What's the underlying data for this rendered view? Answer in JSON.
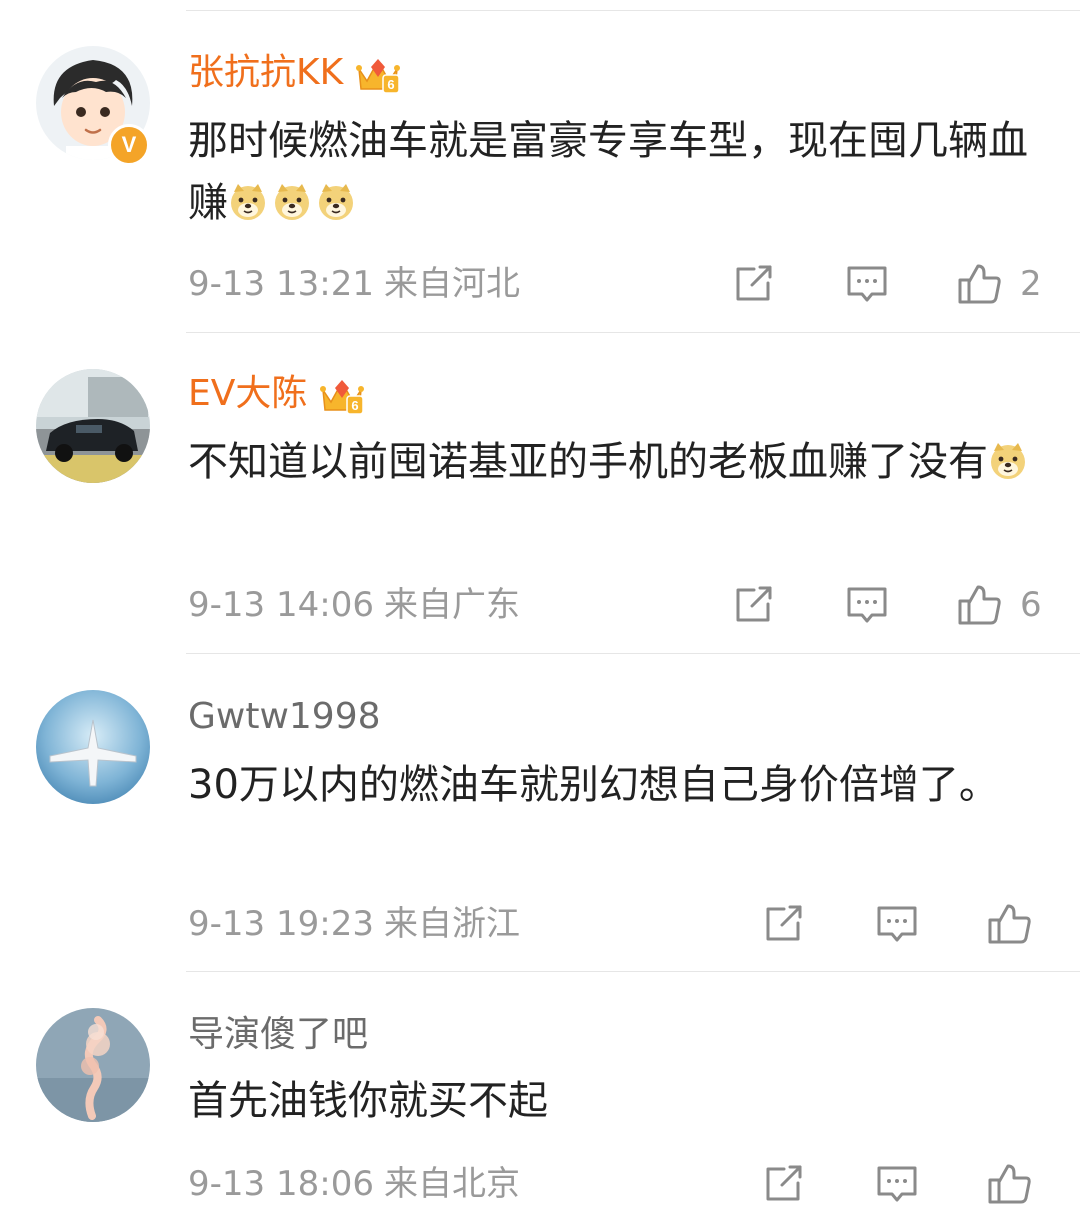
{
  "comments": [
    {
      "username": "张抗抗KK",
      "user_style": "vip",
      "verified": true,
      "verified_badge": "V",
      "crown_icon": "vip-crown-level-6",
      "content": "那时候燃油车就是富豪专享车型，现在囤几辆血赚",
      "emojis": [
        "doge",
        "doge",
        "doge"
      ],
      "time": "9-13 13:21",
      "location": "来自河北",
      "likes": "2"
    },
    {
      "username": "EV大陈",
      "user_style": "vip",
      "verified": false,
      "crown_icon": "vip-crown-level-6",
      "content": "不知道以前囤诺基亚的手机的老板血赚了没有",
      "emojis": [
        "doge"
      ],
      "time": "9-13 14:06",
      "location": "来自广东",
      "likes": "6"
    },
    {
      "username": "Gwtw1998",
      "user_style": "normal",
      "verified": false,
      "content": "30万以内的燃油车就别幻想自己身价倍增了。",
      "emojis": [],
      "time": "9-13 19:23",
      "location": "来自浙江",
      "likes": ""
    },
    {
      "username": "导演傻了吧",
      "user_style": "normal",
      "verified": false,
      "content": "首先油钱你就买不起",
      "emojis": [],
      "time": "9-13 18:06",
      "location": "来自北京",
      "likes": ""
    }
  ],
  "icons": {
    "share": "share-icon",
    "comment": "comment-icon",
    "like": "thumbs-up-icon"
  },
  "colors": {
    "vip_name": "#f06f1c",
    "normal_name": "#6b6b6b",
    "meta": "#9a9a9a",
    "badge": "#f4a428"
  }
}
